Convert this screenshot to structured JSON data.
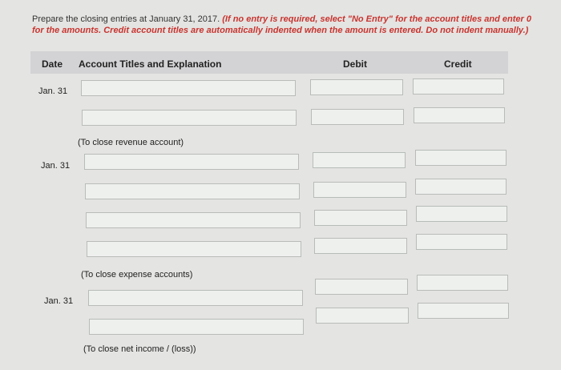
{
  "instructions": {
    "plain": "Prepare the closing entries at January 31, 2017.",
    "emphasis": "(If no entry is required, select \"No Entry\" for the account titles and enter 0 for the amounts. Credit account titles are automatically indented when the amount is entered. Do not indent manually.)"
  },
  "table_header": {
    "date": "Date",
    "account": "Account Titles and Explanation",
    "debit": "Debit",
    "credit": "Credit"
  },
  "entries": [
    {
      "date": "Jan. 31",
      "note": "(To close revenue account)"
    },
    {
      "date": "Jan. 31",
      "note": "(To close expense accounts)"
    },
    {
      "date": "Jan. 31",
      "note": "(To close net income / (loss))"
    }
  ]
}
